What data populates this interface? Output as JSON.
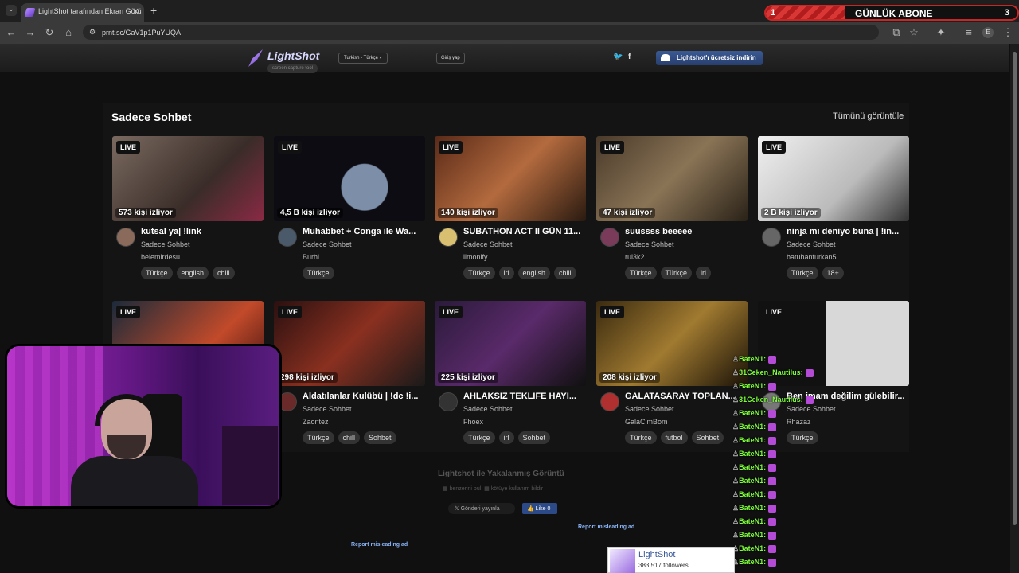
{
  "browser": {
    "tab_title": "LightShot tarafından Ekran Görü",
    "url": "prnt.sc/GaV1p1PuYUQA",
    "profile_initial": "E"
  },
  "abone_widget": {
    "left_number": "1",
    "label": "GÜNLÜK ABONE",
    "right_number": "3"
  },
  "lightshot_header": {
    "logo_name": "LightShot",
    "logo_tagline": "screen capture tool",
    "language": "Turkish - Türkçe",
    "login": "Giriş yap",
    "download": "Lightshot'ı ücretsiz indirin"
  },
  "section": {
    "title": "Sadece Sohbet",
    "view_all": "Tümünü görüntüle"
  },
  "live_label": "LIVE",
  "streams": [
    {
      "viewers": "573 kişi izliyor",
      "title": "kutsal ya| !link",
      "category": "Sadece Sohbet",
      "user": "belemirdesu",
      "tags": [
        "Türkçe",
        "english",
        "chill"
      ],
      "live": true
    },
    {
      "viewers": "4,5 B kişi izliyor",
      "title": "Muhabbet + Conga ile Wa...",
      "category": "Sadece Sohbet",
      "user": "Burhi",
      "tags": [
        "Türkçe"
      ],
      "live": true
    },
    {
      "viewers": "140 kişi izliyor",
      "title": "SUBATHON ACT II GÜN 11...",
      "category": "Sadece Sohbet",
      "user": "limonify",
      "tags": [
        "Türkçe",
        "irl",
        "english",
        "chill"
      ],
      "live": true
    },
    {
      "viewers": "47 kişi izliyor",
      "title": "suussss beeeee",
      "category": "Sadece Sohbet",
      "user": "rul3k2",
      "tags": [
        "Türkçe",
        "Türkçe",
        "irl"
      ],
      "live": true
    },
    {
      "viewers": "2 B kişi izliyor",
      "title": "ninja mı deniyo buna | !in...",
      "category": "Sadece Sohbet",
      "user": "batuhanfurkan5",
      "tags": [
        "Türkçe",
        "18+"
      ],
      "live": true
    },
    {
      "viewers": "",
      "title": "",
      "category": "",
      "user": "",
      "tags": [],
      "live": true
    },
    {
      "viewers": "298 kişi izliyor",
      "title": "Aldatılanlar Kulübü | !dc !i...",
      "category": "Sadece Sohbet",
      "user": "Zaontez",
      "tags": [
        "Türkçe",
        "chill",
        "Sohbet"
      ],
      "live": true
    },
    {
      "viewers": "225 kişi izliyor",
      "title": "AHLAKSIZ TEKLİFE HAYI...",
      "category": "Sadece Sohbet",
      "user": "Fhoex",
      "tags": [
        "Türkçe",
        "irl",
        "Sohbet"
      ],
      "live": true
    },
    {
      "viewers": "208 kişi izliyor",
      "title": "GALATASARAY TOPLAN...",
      "category": "Sadece Sohbet",
      "user": "GalaCimBom",
      "tags": [
        "Türkçe",
        "futbol",
        "Sohbet"
      ],
      "live": true
    },
    {
      "viewers": "",
      "title": "Ben imam değilim gülebilir...",
      "category": "Sadece Sohbet",
      "user": "Rhazaz",
      "tags": [
        "Türkçe"
      ],
      "live": true
    }
  ],
  "chat": [
    {
      "user": "BateN1:"
    },
    {
      "user": "31Ceken_Nautilus:"
    },
    {
      "user": "BateN1:"
    },
    {
      "user": "31Ceken_Nautilus:"
    },
    {
      "user": "BateN1:"
    },
    {
      "user": "BateN1:"
    },
    {
      "user": "BateN1:"
    },
    {
      "user": "BateN1:"
    },
    {
      "user": "BateN1:"
    },
    {
      "user": "BateN1:"
    },
    {
      "user": "BateN1:"
    },
    {
      "user": "BateN1:"
    },
    {
      "user": "BateN1:"
    },
    {
      "user": "BateN1:"
    },
    {
      "user": "BateN1:"
    },
    {
      "user": "BateN1:"
    }
  ],
  "footer": {
    "title": "Lightshot ile Yakalanmış Görüntü",
    "similar": "benzerini bul",
    "report_abuse": "kötüye kullanım bildir",
    "post": "Gönderi yayınla",
    "like": "Like 0",
    "report_ad": "Report misleading ad",
    "fb_name": "LightShot",
    "fb_followers": "383,517 followers"
  },
  "colors": {
    "chat_user": "#7cfc3a",
    "accent_red": "#c92626",
    "link": "#8ab4f8"
  }
}
